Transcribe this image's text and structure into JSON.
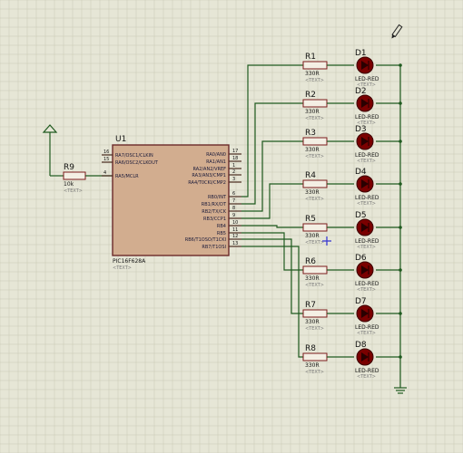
{
  "schematic": {
    "mcu": {
      "ref": "U1",
      "part": "PIC16F628A",
      "text": "<TEXT>",
      "left_pins": [
        {
          "num": "16",
          "label": "RA7/OSC1/CLKIN"
        },
        {
          "num": "15",
          "label": "RA6/OSC2/CLKOUT"
        },
        {
          "num": "4",
          "label": "RA5/MCLR"
        }
      ],
      "right_pins": [
        {
          "num": "17",
          "label": "RA0/AN0"
        },
        {
          "num": "18",
          "label": "RA1/AN1"
        },
        {
          "num": "1",
          "label": "RA2/AN2/VREF"
        },
        {
          "num": "2",
          "label": "RA3/AN3/CMP1"
        },
        {
          "num": "3",
          "label": "RA4/T0CKI/CMP2"
        },
        {
          "num": "6",
          "label": "RB0/INT"
        },
        {
          "num": "7",
          "label": "RB1/RX/DT"
        },
        {
          "num": "8",
          "label": "RB2/TX/CK"
        },
        {
          "num": "9",
          "label": "RB3/CCP1"
        },
        {
          "num": "10",
          "label": "RB4"
        },
        {
          "num": "11",
          "label": "RB5"
        },
        {
          "num": "12",
          "label": "RB6/T1OSO/T1CKI"
        },
        {
          "num": "13",
          "label": "RB7/T1OSI"
        }
      ]
    },
    "r9": {
      "ref": "R9",
      "value": "10k",
      "text": "<TEXT>"
    },
    "channels": [
      {
        "res": "R1",
        "value": "330R",
        "text": "<TEXT>",
        "led": "D1",
        "led_type": "LED-RED",
        "led_text": "<TEXT>"
      },
      {
        "res": "R2",
        "value": "330R",
        "text": "<TEXT>",
        "led": "D2",
        "led_type": "LED-RED",
        "led_text": "<TEXT>"
      },
      {
        "res": "R3",
        "value": "330R",
        "text": "<TEXT>",
        "led": "D3",
        "led_type": "LED-RED",
        "led_text": "<TEXT>"
      },
      {
        "res": "R4",
        "value": "330R",
        "text": "<TEXT>",
        "led": "D4",
        "led_type": "LED-RED",
        "led_text": "<TEXT>"
      },
      {
        "res": "R5",
        "value": "330R",
        "text": "<TEXT>",
        "led": "D5",
        "led_type": "LED-RED",
        "led_text": "<TEXT>"
      },
      {
        "res": "R6",
        "value": "330R",
        "text": "<TEXT>",
        "led": "D6",
        "led_type": "LED-RED",
        "led_text": "<TEXT>"
      },
      {
        "res": "R7",
        "value": "330R",
        "text": "<TEXT>",
        "led": "D7",
        "led_type": "LED-RED",
        "led_text": "<TEXT>"
      },
      {
        "res": "R8",
        "value": "330R",
        "text": "<TEXT>",
        "led": "D8",
        "led_type": "LED-RED",
        "led_text": "<TEXT>"
      }
    ],
    "colors": {
      "background": "#e6e6d6",
      "grid": "#c9c9b4",
      "wire": "#1f5a1f",
      "chip_fill": "#d2ad8f",
      "chip_border": "#6b2a2a",
      "led_fill": "#7a0000",
      "cursor": "#3a3ad0"
    },
    "icons": [
      "power-terminal-icon",
      "ground-icon",
      "pencil-icon",
      "cursor-cross-icon"
    ]
  }
}
